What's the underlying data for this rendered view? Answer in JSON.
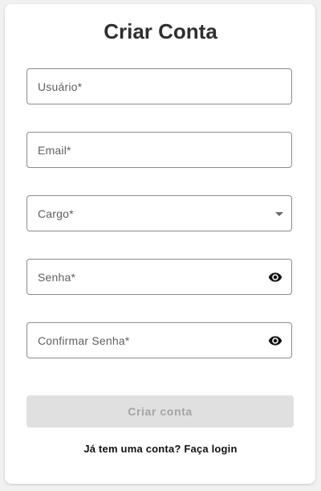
{
  "form": {
    "title": "Criar Conta",
    "fields": {
      "usuario": {
        "label": "Usuário*"
      },
      "email": {
        "label": "Email*"
      },
      "cargo": {
        "label": "Cargo*",
        "icon": "chevron-down-icon"
      },
      "senha": {
        "label": "Senha*",
        "icon": "eye-icon"
      },
      "confirmar_senha": {
        "label": "Confirmar Senha*",
        "icon": "eye-icon"
      }
    },
    "submit_label": "Criar conta",
    "login_link": "Já tem uma conta? Faça login"
  },
  "colors": {
    "page_background": "#f1f1f1",
    "card_background": "#ffffff",
    "field_border": "#8c8c8c",
    "button_disabled_bg": "#e0e0e0",
    "button_disabled_text": "#a4a4a4"
  }
}
